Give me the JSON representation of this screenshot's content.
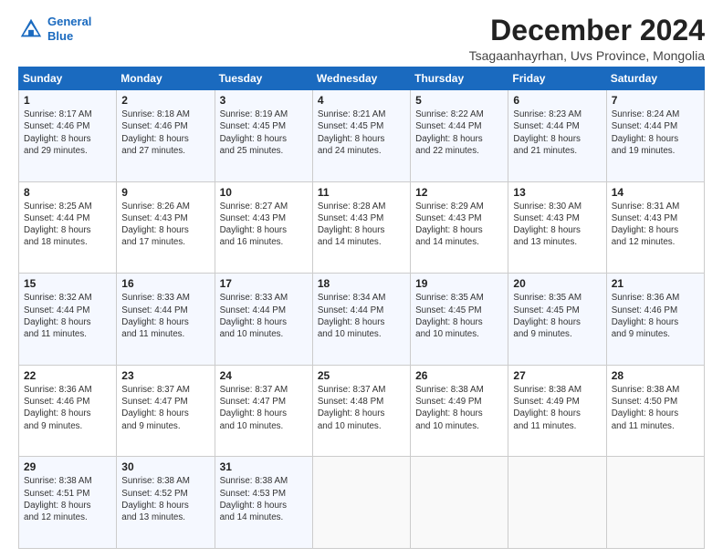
{
  "logo": {
    "line1": "General",
    "line2": "Blue"
  },
  "title": "December 2024",
  "subtitle": "Tsagaanhayrhan, Uvs Province, Mongolia",
  "header": {
    "days": [
      "Sunday",
      "Monday",
      "Tuesday",
      "Wednesday",
      "Thursday",
      "Friday",
      "Saturday"
    ]
  },
  "weeks": [
    [
      {
        "day": "1",
        "text": "Sunrise: 8:17 AM\nSunset: 4:46 PM\nDaylight: 8 hours\nand 29 minutes."
      },
      {
        "day": "2",
        "text": "Sunrise: 8:18 AM\nSunset: 4:46 PM\nDaylight: 8 hours\nand 27 minutes."
      },
      {
        "day": "3",
        "text": "Sunrise: 8:19 AM\nSunset: 4:45 PM\nDaylight: 8 hours\nand 25 minutes."
      },
      {
        "day": "4",
        "text": "Sunrise: 8:21 AM\nSunset: 4:45 PM\nDaylight: 8 hours\nand 24 minutes."
      },
      {
        "day": "5",
        "text": "Sunrise: 8:22 AM\nSunset: 4:44 PM\nDaylight: 8 hours\nand 22 minutes."
      },
      {
        "day": "6",
        "text": "Sunrise: 8:23 AM\nSunset: 4:44 PM\nDaylight: 8 hours\nand 21 minutes."
      },
      {
        "day": "7",
        "text": "Sunrise: 8:24 AM\nSunset: 4:44 PM\nDaylight: 8 hours\nand 19 minutes."
      }
    ],
    [
      {
        "day": "8",
        "text": "Sunrise: 8:25 AM\nSunset: 4:44 PM\nDaylight: 8 hours\nand 18 minutes."
      },
      {
        "day": "9",
        "text": "Sunrise: 8:26 AM\nSunset: 4:43 PM\nDaylight: 8 hours\nand 17 minutes."
      },
      {
        "day": "10",
        "text": "Sunrise: 8:27 AM\nSunset: 4:43 PM\nDaylight: 8 hours\nand 16 minutes."
      },
      {
        "day": "11",
        "text": "Sunrise: 8:28 AM\nSunset: 4:43 PM\nDaylight: 8 hours\nand 14 minutes."
      },
      {
        "day": "12",
        "text": "Sunrise: 8:29 AM\nSunset: 4:43 PM\nDaylight: 8 hours\nand 14 minutes."
      },
      {
        "day": "13",
        "text": "Sunrise: 8:30 AM\nSunset: 4:43 PM\nDaylight: 8 hours\nand 13 minutes."
      },
      {
        "day": "14",
        "text": "Sunrise: 8:31 AM\nSunset: 4:43 PM\nDaylight: 8 hours\nand 12 minutes."
      }
    ],
    [
      {
        "day": "15",
        "text": "Sunrise: 8:32 AM\nSunset: 4:44 PM\nDaylight: 8 hours\nand 11 minutes."
      },
      {
        "day": "16",
        "text": "Sunrise: 8:33 AM\nSunset: 4:44 PM\nDaylight: 8 hours\nand 11 minutes."
      },
      {
        "day": "17",
        "text": "Sunrise: 8:33 AM\nSunset: 4:44 PM\nDaylight: 8 hours\nand 10 minutes."
      },
      {
        "day": "18",
        "text": "Sunrise: 8:34 AM\nSunset: 4:44 PM\nDaylight: 8 hours\nand 10 minutes."
      },
      {
        "day": "19",
        "text": "Sunrise: 8:35 AM\nSunset: 4:45 PM\nDaylight: 8 hours\nand 10 minutes."
      },
      {
        "day": "20",
        "text": "Sunrise: 8:35 AM\nSunset: 4:45 PM\nDaylight: 8 hours\nand 9 minutes."
      },
      {
        "day": "21",
        "text": "Sunrise: 8:36 AM\nSunset: 4:46 PM\nDaylight: 8 hours\nand 9 minutes."
      }
    ],
    [
      {
        "day": "22",
        "text": "Sunrise: 8:36 AM\nSunset: 4:46 PM\nDaylight: 8 hours\nand 9 minutes."
      },
      {
        "day": "23",
        "text": "Sunrise: 8:37 AM\nSunset: 4:47 PM\nDaylight: 8 hours\nand 9 minutes."
      },
      {
        "day": "24",
        "text": "Sunrise: 8:37 AM\nSunset: 4:47 PM\nDaylight: 8 hours\nand 10 minutes."
      },
      {
        "day": "25",
        "text": "Sunrise: 8:37 AM\nSunset: 4:48 PM\nDaylight: 8 hours\nand 10 minutes."
      },
      {
        "day": "26",
        "text": "Sunrise: 8:38 AM\nSunset: 4:49 PM\nDaylight: 8 hours\nand 10 minutes."
      },
      {
        "day": "27",
        "text": "Sunrise: 8:38 AM\nSunset: 4:49 PM\nDaylight: 8 hours\nand 11 minutes."
      },
      {
        "day": "28",
        "text": "Sunrise: 8:38 AM\nSunset: 4:50 PM\nDaylight: 8 hours\nand 11 minutes."
      }
    ],
    [
      {
        "day": "29",
        "text": "Sunrise: 8:38 AM\nSunset: 4:51 PM\nDaylight: 8 hours\nand 12 minutes."
      },
      {
        "day": "30",
        "text": "Sunrise: 8:38 AM\nSunset: 4:52 PM\nDaylight: 8 hours\nand 13 minutes."
      },
      {
        "day": "31",
        "text": "Sunrise: 8:38 AM\nSunset: 4:53 PM\nDaylight: 8 hours\nand 14 minutes."
      },
      {
        "day": "",
        "text": ""
      },
      {
        "day": "",
        "text": ""
      },
      {
        "day": "",
        "text": ""
      },
      {
        "day": "",
        "text": ""
      }
    ]
  ]
}
